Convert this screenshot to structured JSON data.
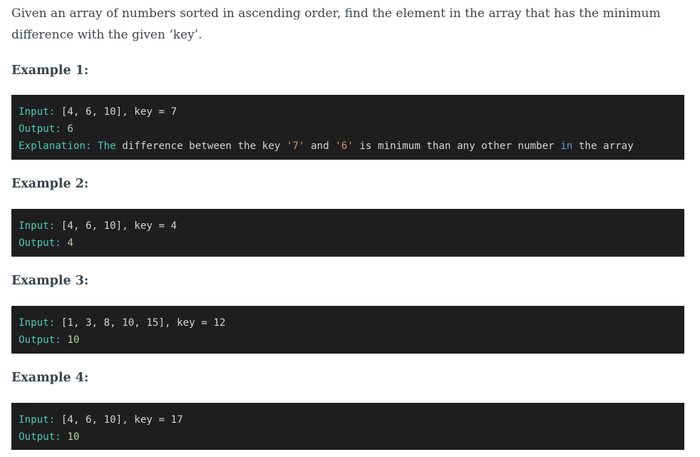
{
  "intro": {
    "line1": "Given an array of numbers sorted in ascending order, find the element in the array that has the minimum",
    "line2": "difference with the given ‘key’."
  },
  "examples": [
    {
      "heading": "Example 1:",
      "input_label": "Input:",
      "input_value": " [4, 6, 10], key = 7",
      "output_label": "Output:",
      "output_value": " 6",
      "explanation_label": "Explanation:",
      "explanation_the": "The",
      "explanation_part1": " difference between the key ",
      "explanation_q1": "'7'",
      "explanation_and": " and ",
      "explanation_q2": "'6'",
      "explanation_part2": " is minimum than any other number ",
      "explanation_in": "in",
      "explanation_part3": " the array"
    },
    {
      "heading": "Example 2:",
      "input_label": "Input:",
      "input_value": " [4, 6, 10], key = 4",
      "output_label": "Output:",
      "output_value": " 4"
    },
    {
      "heading": "Example 3:",
      "input_label": "Input:",
      "input_value": " [1, 3, 8, 10, 15], key = 12",
      "output_label": "Output:",
      "output_value": " 10"
    },
    {
      "heading": "Example 4:",
      "input_label": "Input:",
      "input_value": " [4, 6, 10], key = 17",
      "output_label": "Output:",
      "output_value": " 10"
    }
  ]
}
